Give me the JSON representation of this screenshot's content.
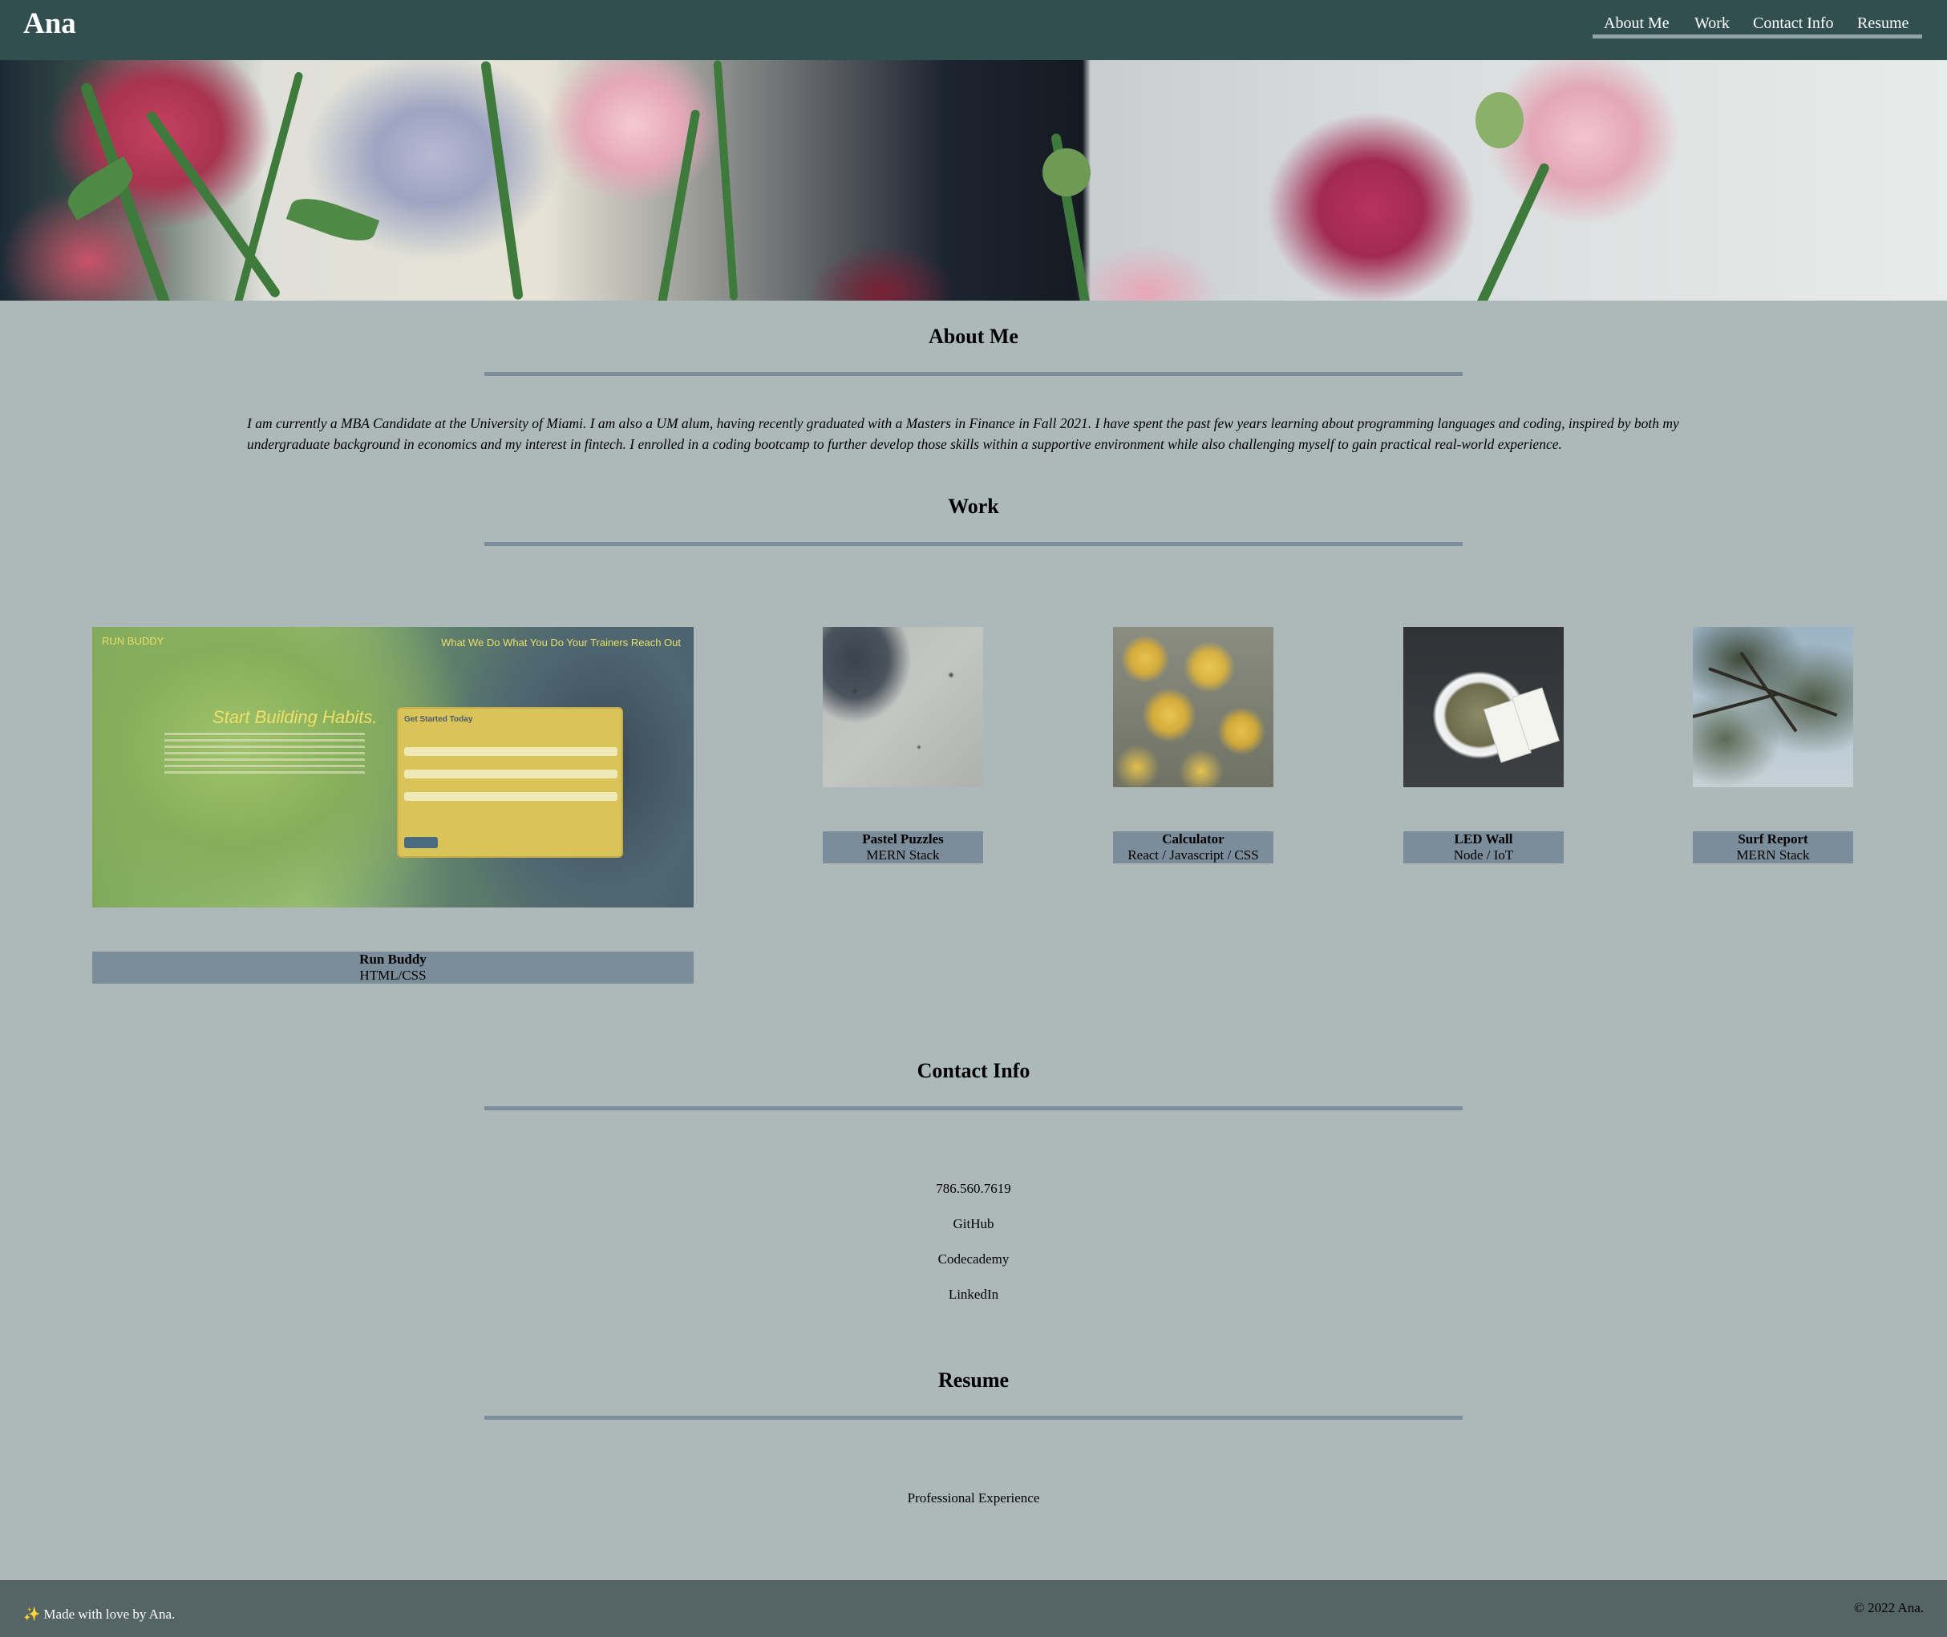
{
  "header": {
    "brand": "Ana",
    "nav": [
      "About Me",
      "Work",
      "Contact Info",
      "Resume"
    ]
  },
  "about": {
    "title": "About Me",
    "text": "I am currently a MBA Candidate at the University of Miami. I am also a UM alum, having recently graduated with a Masters in Finance in Fall 2021. I have spent the past few years learning about programming languages and coding, inspired by both my undergraduate background in economics and my interest in fintech. I enrolled in a coding bootcamp to further develop those skills within a supportive environment while also challenging myself to gain practical real-world experience."
  },
  "work": {
    "title": "Work",
    "featured": {
      "title": "Run Buddy",
      "stack": "HTML/CSS",
      "preview": {
        "logo": "RUN BUDDY",
        "nav": "What We Do   What You Do   Your Trainers   Reach Out",
        "headline": "Start Building Habits.",
        "form_title": "Get Started Today"
      }
    },
    "projects": [
      {
        "title": "Pastel Puzzles",
        "stack": "MERN Stack"
      },
      {
        "title": "Calculator",
        "stack": "React / Javascript / CSS"
      },
      {
        "title": "LED Wall",
        "stack": "Node / IoT"
      },
      {
        "title": "Surf Report",
        "stack": "MERN Stack"
      }
    ]
  },
  "contact": {
    "title": "Contact Info",
    "items": [
      "786.560.7619",
      "GitHub",
      "Codecademy",
      "LinkedIn"
    ]
  },
  "resume": {
    "title": "Resume",
    "link": "Professional Experience"
  },
  "footer": {
    "left": "✨ Made with love by Ana.",
    "right": "© 2022 Ana."
  },
  "colors": {
    "header_bg": "#324f50",
    "page_bg": "#adb9b9",
    "caption_bg": "#7b8c9a",
    "footer_bg": "#556565"
  }
}
